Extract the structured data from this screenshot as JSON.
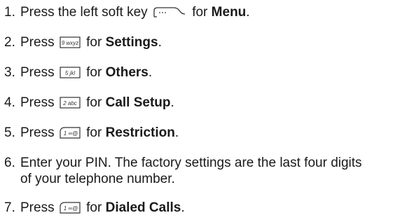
{
  "steps": [
    {
      "num": "1.",
      "pre": "Press the left soft key",
      "icon": "left-soft-key-icon",
      "mid": "for",
      "bold": "Menu",
      "post": "."
    },
    {
      "num": "2.",
      "pre": "Press",
      "icon": "key-9-wxyz-icon",
      "key_text": "9 wxyz",
      "mid": "for",
      "bold": "Settings",
      "post": "."
    },
    {
      "num": "3.",
      "pre": "Press",
      "icon": "key-5-jkl-icon",
      "key_text": "5 jkl",
      "mid": "for",
      "bold": "Others",
      "post": "."
    },
    {
      "num": "4.",
      "pre": "Press",
      "icon": "key-2-abc-icon",
      "key_text": "2 abc",
      "mid": "for",
      "bold": "Call Setup",
      "post": "."
    },
    {
      "num": "5.",
      "pre": "Press",
      "icon": "key-1-icon",
      "key_text": "1 ∞@",
      "mid": "for",
      "bold": "Restriction",
      "post": "."
    },
    {
      "num": "6.",
      "line1": "Enter your PIN. The factory settings are the last four digits",
      "line2": "of your telephone number."
    },
    {
      "num": "7.",
      "pre": "Press",
      "icon": "key-1-icon",
      "key_text": "1 ∞@",
      "mid": "for",
      "bold": "Dialed Calls",
      "post": "."
    }
  ],
  "colors": {
    "text": "#1a1a1a",
    "key_outline": "#333333"
  }
}
